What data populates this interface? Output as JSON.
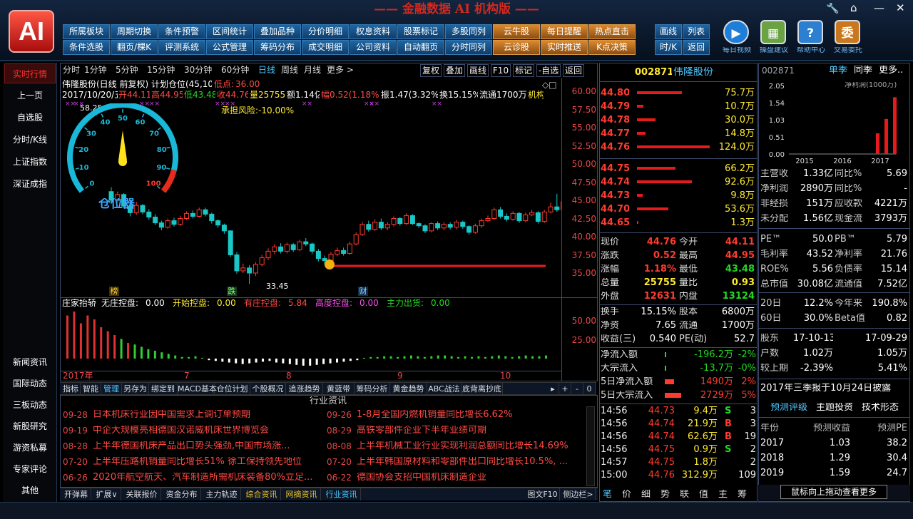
{
  "app": {
    "logo": "AI",
    "title": "—— 金融数据 AI 机构版 ——"
  },
  "window": {
    "tool_icon": "wrench-icon",
    "home_icon": "home-icon",
    "min": "—",
    "close": "✕"
  },
  "toolbar_row1": [
    "所属板块",
    "周期切换",
    "条件预警",
    "区间统计",
    "叠加品种",
    "分价明细",
    "权息资料",
    "股票标记",
    "多股同列",
    "云牛股",
    "每日提醒",
    "热点直击"
  ],
  "toolbar_row2": [
    "条件选股",
    "翻页/棵K",
    "评测系统",
    "公式管理",
    "筹码分布",
    "成交明细",
    "公司资料",
    "自动翻页",
    "分时同列",
    "云诊股",
    "实时推送",
    "K点决策"
  ],
  "view_buttons": {
    "r1": [
      "画线",
      "列表"
    ],
    "r2": [
      "时/K",
      "返回"
    ]
  },
  "big_icons": [
    "每日视频",
    "操盘建议",
    "帮助中心",
    "交易委托"
  ],
  "sidebar_top": [
    "实时行情",
    "上一页",
    "自选股",
    "分时/K线",
    "上证指数",
    "深证成指"
  ],
  "sidebar_bottom": [
    "新闻资讯",
    "国际动态",
    "三板动态",
    "新股研究",
    "游资私募",
    "专家评论",
    "其他"
  ],
  "chart_toolbar": {
    "periods": [
      "分时",
      "1分钟",
      "5分钟",
      "15分钟",
      "30分钟",
      "60分钟",
      "日线",
      "周线",
      "月线",
      "更多 >"
    ],
    "active": "日线",
    "right": [
      "复权",
      "叠加",
      "画线",
      "F10",
      "标记",
      "-自选",
      "返回"
    ]
  },
  "chart_info": {
    "line1_name": "伟隆股份(日线 前复权) 计划仓位(45,10)",
    "low_label": "低点:",
    "low_value": "36.00",
    "line2": "2017/10/20/五",
    "open": "开44.11",
    "high": "高44.95",
    "low": "低43.48",
    "close": "收44.76",
    "vol": "量25755",
    "amt": "额1.14亿",
    "rng": "幅0.52(1.18%)",
    "amp": "振1.47(3.32%)",
    "turn": "换15.15%",
    "float": "流通1700万",
    "org": "机构",
    "risk": "承担风险:-10.00%",
    "max_label": "58.25",
    "min_label": "33.45",
    "marks": [
      "榜",
      "跌",
      "财"
    ],
    "gauge_title": "仓位器",
    "gauge_ticks": [
      "0",
      "10",
      "20",
      "30",
      "40",
      "50",
      "60",
      "70",
      "80",
      "90",
      "100"
    ],
    "gauge_value": "50"
  },
  "price_axis": [
    "60.00",
    "57.50",
    "55.00",
    "52.50",
    "50.00",
    "47.50",
    "45.00",
    "42.50",
    "40.00",
    "37.50",
    "35.00"
  ],
  "indicator": {
    "name": "庄家抬轿",
    "items": [
      {
        "label": "无庄控盘:",
        "value": "0.00",
        "color": "#ffffff"
      },
      {
        "label": "开始控盘:",
        "value": "0.00",
        "color": "#ffea30"
      },
      {
        "label": "有庄控盘:",
        "value": "5.84",
        "color": "#ff4a44"
      },
      {
        "label": "高度控盘:",
        "value": "0.00",
        "color": "#ff4df0"
      },
      {
        "label": "主力出货:",
        "value": "0.00",
        "color": "#22d922"
      }
    ],
    "axis": [
      "50.00",
      "25.00"
    ]
  },
  "date_axis": [
    "2017年",
    "7",
    "8",
    "9",
    "10"
  ],
  "bottom_tabs": [
    "指标",
    "智能",
    "管理",
    "另存为",
    "绑定到",
    "MACD基本",
    "仓位计划",
    "个股概况",
    "追涨趋势",
    "黄蓝带",
    "筹码分析",
    "黄金趋势",
    "ABC战法",
    "底背离抄底"
  ],
  "news": {
    "title": "行业资讯",
    "left": [
      [
        "09-28",
        "日本机床行业因中国需求上调订单预期"
      ],
      [
        "09-19",
        "中企大规模亮相德国汉诺威机床世界博览会"
      ],
      [
        "08-28",
        "上半年德国机床产品出口势头强劲,中国市场涨..."
      ],
      [
        "07-20",
        "上半年压路机销量同比增长51% 徐工保持领先地位"
      ],
      [
        "06-26",
        "2020年航空航天、汽车制造所需机床装备80%立足..."
      ]
    ],
    "right": [
      [
        "09-26",
        "1-8月全国内燃机销量同比增长6.62%"
      ],
      [
        "08-29",
        "高铁零部件企业下半年业绩可期"
      ],
      [
        "08-08",
        "上半年机械工业行业实现利润总额同比增长14.69%"
      ],
      [
        "07-20",
        "上半年韩国原材料和零部件出口同比增长10.5%, ..."
      ],
      [
        "06-22",
        "德国协会支招中国机床制造企业"
      ]
    ]
  },
  "footer_tabs": [
    "开弹幕",
    "扩展∨",
    "关联报价",
    "资金分布",
    "主力轨迹",
    "综合资讯",
    "网摘资讯",
    "行业资讯"
  ],
  "footer_right": [
    "图文F10",
    "侧边栏>"
  ],
  "quote": {
    "code": "002871",
    "name": "伟隆股份",
    "asks": [
      [
        "44.80",
        "75.7万",
        0.62
      ],
      [
        "44.79",
        "10.7万",
        0.09
      ],
      [
        "44.78",
        "30.0万",
        0.25
      ],
      [
        "44.77",
        "14.8万",
        0.12
      ],
      [
        "44.76",
        "124.0万",
        1.0
      ]
    ],
    "bids": [
      [
        "44.75",
        "66.2万",
        0.53
      ],
      [
        "44.74",
        "92.6万",
        0.75
      ],
      [
        "44.73",
        "9.8万",
        0.08
      ],
      [
        "44.70",
        "53.6万",
        0.43
      ],
      [
        "44.65",
        "1.3万",
        0.02
      ]
    ],
    "stats": [
      [
        "现价",
        "44.76",
        "red",
        "今开",
        "44.11",
        "red"
      ],
      [
        "涨跌",
        "0.52",
        "red",
        "最高",
        "44.95",
        "red"
      ],
      [
        "涨幅",
        "1.18%",
        "red",
        "最低",
        "43.48",
        "green"
      ],
      [
        "总量",
        "25755",
        "yellow",
        "量比",
        "0.93",
        "yellow"
      ],
      [
        "外盘",
        "12631",
        "red",
        "内盘",
        "13124",
        "green"
      ]
    ],
    "stats2": [
      [
        "换手",
        "15.15%",
        "白",
        "股本",
        "6800万"
      ],
      [
        "净资",
        "7.65",
        "白",
        "流通",
        "1700万"
      ],
      [
        "收益(三)",
        "0.540",
        "白",
        "PE(动)",
        "52.7"
      ]
    ],
    "flows": [
      [
        "净流入额",
        "-196.2万",
        "-2%",
        "green",
        0.05
      ],
      [
        "大宗流入",
        "-13.7万",
        "-0%",
        "green",
        0.02
      ],
      [
        "5日净流入额",
        "1490万",
        "2%",
        "red",
        0.5
      ],
      [
        "5日大宗流入",
        "2729万",
        "5%",
        "red",
        0.9
      ]
    ],
    "ticks": [
      [
        "14:56",
        "44.73",
        "9.4万",
        "S",
        "3"
      ],
      [
        "14:56",
        "44.74",
        "21.9万",
        "B",
        "3"
      ],
      [
        "14:56",
        "44.74",
        "62.6万",
        "B",
        "19"
      ],
      [
        "14:56",
        "44.75",
        "0.9万",
        "S",
        "2"
      ],
      [
        "14:57",
        "44.75",
        "1.8万",
        "",
        "2"
      ],
      [
        "15:00",
        "44.76",
        "312.9万",
        "",
        "109"
      ]
    ],
    "tick_tabs": [
      "笔",
      "价",
      "细",
      "势",
      "联",
      "值",
      "主",
      "筹"
    ]
  },
  "f10": {
    "code": "002871",
    "tabs": [
      "单季",
      "同季",
      "更多.."
    ],
    "chart_label": "净利润(1000万)",
    "y_ticks": [
      "2.05",
      "1.54",
      "1.03",
      "0.51",
      "0.00"
    ],
    "x_ticks": [
      "2015",
      "2016",
      "2017"
    ],
    "bars": [
      0.0,
      0.0,
      0.0,
      0.0,
      0.0,
      0.0,
      0.0,
      0.0,
      0.0,
      0.0,
      0.62,
      1.05,
      1.7
    ],
    "rows": [
      [
        "主营收",
        "1.33亿",
        "同比%",
        "5.69"
      ],
      [
        "净利润",
        "2890万",
        "同比%",
        "-"
      ],
      [
        "非经损",
        "151万",
        "应收款",
        "4221万"
      ],
      [
        "未分配",
        "1.56亿",
        "现金流",
        "3793万"
      ]
    ],
    "rows2": [
      [
        "PE™",
        "50.0",
        "PB™",
        "5.79"
      ],
      [
        "毛利率",
        "43.52",
        "净利率",
        "21.76"
      ],
      [
        "ROE%",
        "5.56",
        "负债率",
        "15.14"
      ],
      [
        "总市值",
        "30.08亿",
        "流通值",
        "7.52亿"
      ]
    ],
    "rows3": [
      [
        "20日",
        "12.2%",
        "今年来",
        "190.8%"
      ],
      [
        "60日",
        "30.0%",
        "Beta值",
        "0.82"
      ]
    ],
    "rows4": [
      [
        "股东",
        "17-10-13",
        "17-09-29"
      ],
      [
        "户数",
        "1.02万",
        "1.05万"
      ],
      [
        "较上期",
        "-2.39%",
        "5.41%"
      ]
    ],
    "report": "2017年三季报于10月24日披露",
    "sub_tabs": [
      "预测评级",
      "主题投资",
      "技术形态"
    ],
    "fc_head": [
      "年份",
      "预测收益",
      "预测PE"
    ],
    "fc": [
      [
        "2017",
        "1.03",
        "38.2"
      ],
      [
        "2018",
        "1.29",
        "30.4"
      ],
      [
        "2019",
        "1.59",
        "24.7"
      ]
    ],
    "tooltip": "鼠标向上拖动查看更多"
  },
  "colors": {
    "up": "#ff3b30",
    "down": "#19c7c7",
    "bg": "#000000"
  },
  "candles": [
    [
      46.2,
      45.0,
      46.8,
      44.5
    ],
    [
      45.0,
      45.8,
      46.2,
      44.7
    ],
    [
      45.8,
      44.2,
      46.0,
      43.9
    ],
    [
      44.2,
      43.3,
      44.6,
      42.8
    ],
    [
      43.3,
      44.3,
      44.8,
      43.0
    ],
    [
      44.3,
      43.4,
      44.5,
      43.1
    ],
    [
      43.4,
      42.7,
      43.8,
      42.3
    ],
    [
      42.7,
      41.9,
      43.1,
      41.6
    ],
    [
      41.9,
      41.3,
      42.2,
      40.9
    ],
    [
      41.3,
      42.2,
      42.5,
      41.1
    ],
    [
      42.2,
      41.7,
      42.6,
      41.4
    ],
    [
      41.7,
      42.5,
      42.9,
      41.5
    ],
    [
      42.5,
      43.2,
      43.5,
      42.3
    ],
    [
      43.2,
      42.8,
      43.6,
      42.5
    ],
    [
      42.8,
      43.7,
      44.0,
      42.6
    ],
    [
      43.7,
      43.1,
      44.0,
      42.8
    ],
    [
      43.1,
      42.2,
      43.3,
      41.8
    ],
    [
      42.2,
      41.6,
      42.4,
      41.2
    ],
    [
      41.6,
      40.8,
      41.8,
      40.4
    ],
    [
      40.8,
      37.5,
      40.9,
      37.2
    ],
    [
      37.5,
      35.3,
      37.9,
      34.9
    ],
    [
      35.3,
      35.7,
      36.3,
      35.0
    ],
    [
      35.7,
      35.0,
      36.1,
      33.5
    ],
    [
      35.0,
      36.2,
      36.5,
      34.6
    ],
    [
      36.2,
      37.1,
      37.5,
      35.9
    ],
    [
      37.1,
      38.0,
      38.4,
      36.8
    ],
    [
      38.0,
      38.6,
      39.0,
      37.6
    ],
    [
      38.6,
      38.0,
      39.1,
      37.7
    ],
    [
      38.0,
      38.9,
      39.2,
      37.7
    ],
    [
      38.9,
      38.2,
      39.1,
      37.9
    ],
    [
      38.2,
      39.3,
      39.6,
      38.0
    ],
    [
      39.3,
      39.0,
      39.8,
      38.7
    ],
    [
      39.0,
      38.0,
      39.2,
      37.6
    ],
    [
      38.0,
      37.0,
      38.3,
      36.6
    ],
    [
      37.0,
      36.7,
      37.4,
      36.2
    ],
    [
      36.7,
      37.6,
      37.9,
      36.4
    ],
    [
      37.6,
      38.1,
      38.5,
      37.3
    ],
    [
      38.1,
      37.7,
      38.5,
      37.4
    ],
    [
      37.7,
      39.0,
      39.3,
      37.5
    ],
    [
      39.0,
      40.3,
      40.6,
      38.8
    ],
    [
      40.3,
      41.7,
      42.0,
      40.1
    ],
    [
      41.7,
      41.0,
      42.2,
      40.7
    ],
    [
      41.0,
      42.0,
      42.4,
      40.8
    ],
    [
      42.0,
      41.2,
      42.5,
      40.9
    ],
    [
      41.2,
      41.7,
      42.0,
      40.9
    ],
    [
      41.7,
      42.5,
      42.8,
      41.4
    ],
    [
      42.5,
      41.8,
      42.7,
      41.5
    ],
    [
      41.8,
      42.9,
      43.2,
      41.6
    ],
    [
      42.9,
      41.8,
      43.1,
      41.6
    ],
    [
      41.8,
      41.5,
      42.0,
      41.2
    ],
    [
      41.5,
      40.8,
      41.7,
      40.5
    ],
    [
      40.8,
      41.8,
      42.0,
      40.6
    ],
    [
      41.8,
      41.2,
      42.1,
      40.9
    ],
    [
      41.2,
      41.7,
      42.0,
      40.9
    ],
    [
      41.7,
      41.3,
      42.0,
      41.0
    ],
    [
      41.3,
      42.0,
      42.3,
      41.0
    ],
    [
      42.0,
      41.4,
      42.2,
      41.1
    ],
    [
      41.4,
      40.6,
      41.6,
      40.3
    ],
    [
      40.6,
      41.5,
      41.8,
      40.4
    ],
    [
      41.5,
      42.2,
      42.5,
      41.2
    ],
    [
      42.2,
      42.5,
      42.9,
      42.0
    ],
    [
      42.5,
      43.7,
      44.0,
      42.3
    ],
    [
      43.7,
      42.8,
      44.1,
      42.5
    ],
    [
      42.8,
      42.4,
      43.2,
      42.1
    ],
    [
      42.4,
      43.2,
      43.5,
      42.2
    ],
    [
      43.2,
      42.2,
      43.4,
      41.9
    ],
    [
      42.2,
      43.0,
      43.3,
      42.0
    ],
    [
      43.0,
      43.3,
      43.7,
      42.8
    ],
    [
      43.3,
      42.1,
      43.5,
      41.8
    ],
    [
      42.1,
      43.4,
      43.7,
      41.9
    ],
    [
      43.4,
      44.1,
      44.7,
      43.2
    ],
    [
      44.1,
      43.7,
      45.9,
      43.4
    ],
    [
      43.7,
      44.8,
      45.0,
      43.5
    ]
  ],
  "ind_bars": [
    0.55,
    0.6,
    0.45,
    0.55,
    0.5,
    0.4,
    0.35,
    0.3,
    0.25,
    0.2,
    0.18,
    0.15,
    0.12,
    0.1,
    0.08,
    0.06,
    0.04,
    0.02,
    0.02,
    0.03,
    0.01,
    -0.02,
    -0.03,
    -0.04,
    -0.05,
    -0.06,
    -0.07,
    -0.06,
    -0.05,
    -0.04,
    -0.03,
    -0.05,
    -0.06,
    -0.07,
    -0.08,
    -0.09,
    -0.09,
    -0.08,
    -0.07,
    -0.06,
    -0.05,
    -0.04,
    -0.03,
    -0.02,
    0.01,
    0.02,
    0.02,
    0.03,
    0.03,
    0.02,
    0.03,
    0.04,
    0.03,
    0.02,
    0.03,
    0.04,
    0.04,
    0.03,
    0.02,
    0.03,
    0.02,
    0.03,
    0.02,
    0.03,
    0.04,
    0.03,
    0.02,
    0.03,
    0.04,
    0.03,
    0.03,
    0.04
  ]
}
